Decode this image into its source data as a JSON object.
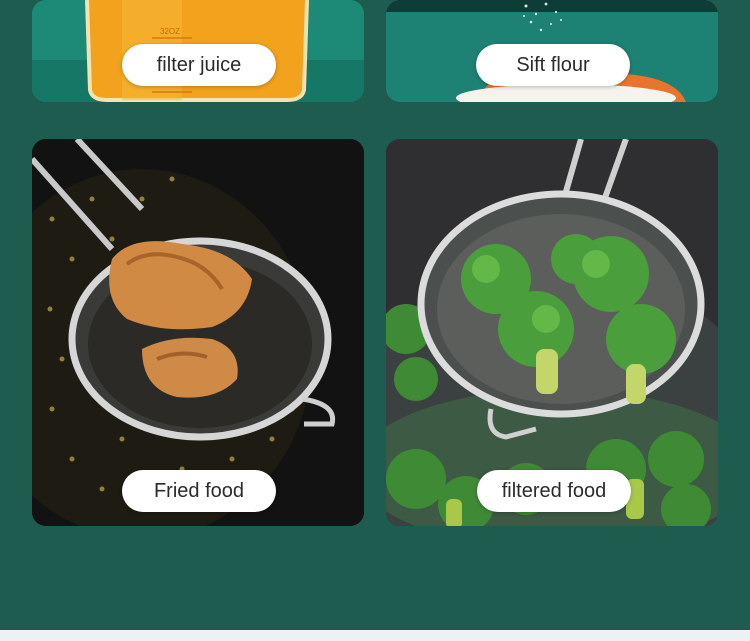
{
  "tiles": [
    {
      "label": "filter juice",
      "icon": "juice-glass-image"
    },
    {
      "label": "Sift flour",
      "icon": "flour-sift-image"
    },
    {
      "label": "Fried food",
      "icon": "fried-food-strainer-image"
    },
    {
      "label": "filtered food",
      "icon": "broccoli-strainer-image"
    }
  ],
  "measuring_cup": {
    "mark_top": "32OZ"
  },
  "colors": {
    "background": "#1d5c4e",
    "label_bg": "#ffffff",
    "label_text": "#2b2b2b"
  }
}
